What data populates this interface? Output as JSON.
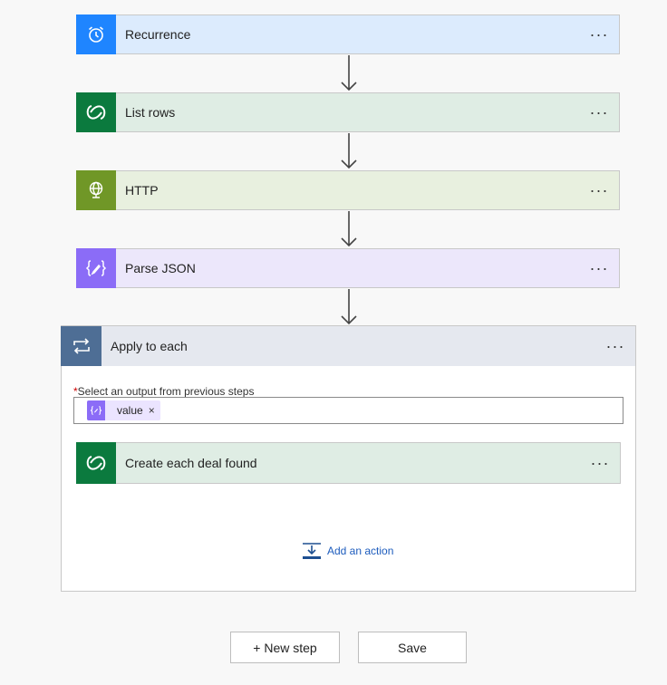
{
  "steps": [
    {
      "label": "Recurrence",
      "icon": "alarm-clock-icon",
      "icon_bg": "#1f85ff",
      "bg": "#dcebfd"
    },
    {
      "label": "List rows",
      "icon": "dataverse-icon",
      "icon_bg": "#0b7a3e",
      "bg": "#dfede4"
    },
    {
      "label": "HTTP",
      "icon": "globe-icon",
      "icon_bg": "#709727",
      "bg": "#e8f0df"
    },
    {
      "label": "Parse JSON",
      "icon": "json-braces-icon",
      "icon_bg": "#8b6cf7",
      "bg": "#ece7fb"
    }
  ],
  "more_glyph": "···",
  "apply_each": {
    "label": "Apply to each",
    "icon": "loop-icon",
    "icon_bg": "#4e6e95",
    "select_required_marker": "*",
    "select_label": "Select an output from previous steps",
    "token": {
      "label": "value",
      "remove": "×"
    },
    "inner_step": {
      "label": "Create each deal found",
      "icon": "dataverse-icon"
    },
    "add_action": "Add an action"
  },
  "buttons": {
    "new_step": "+ New step",
    "save": "Save"
  }
}
